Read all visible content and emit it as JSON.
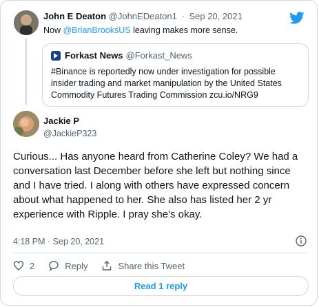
{
  "parent_tweet": {
    "author_name": "John E Deaton",
    "author_handle": "@JohnEDeaton1",
    "separator": "·",
    "date": "Sep 20, 2021",
    "text_prefix": "Now ",
    "mention": "@BrianBrooksUS",
    "text_suffix": " leaving makes more sense."
  },
  "quoted_tweet": {
    "author_name": "Forkast News",
    "author_handle": "@Forkast_News",
    "text": "#Binance is reportedly now under investigation for possible insider trading and market manipulation by the United States Commodity Futures Trading Commission zcu.io/NRG9"
  },
  "tweet": {
    "author_name": "Jackie P",
    "author_handle": "@JackieP323",
    "text": "Curious... Has anyone heard from Catherine Coley? We had a conversation last December before she left but nothing since and I have tried. I along with others have expressed concern about what happened to her. She also has listed her 2 yr experience with Ripple. I pray she's okay.",
    "timestamp": "4:18 PM · Sep 20, 2021"
  },
  "actions": {
    "like_count": "2",
    "reply_label": "Reply",
    "share_label": "Share this Tweet"
  },
  "read_replies_label": "Read 1 reply",
  "icons": {
    "brand": "twitter-bird-icon",
    "like": "heart-icon",
    "reply": "speech-bubble-icon",
    "share": "share-icon",
    "info": "info-icon"
  },
  "colors": {
    "accent": "#1d9bf0",
    "text": "#0f1419",
    "muted": "#536471",
    "border": "#cfd9de"
  }
}
